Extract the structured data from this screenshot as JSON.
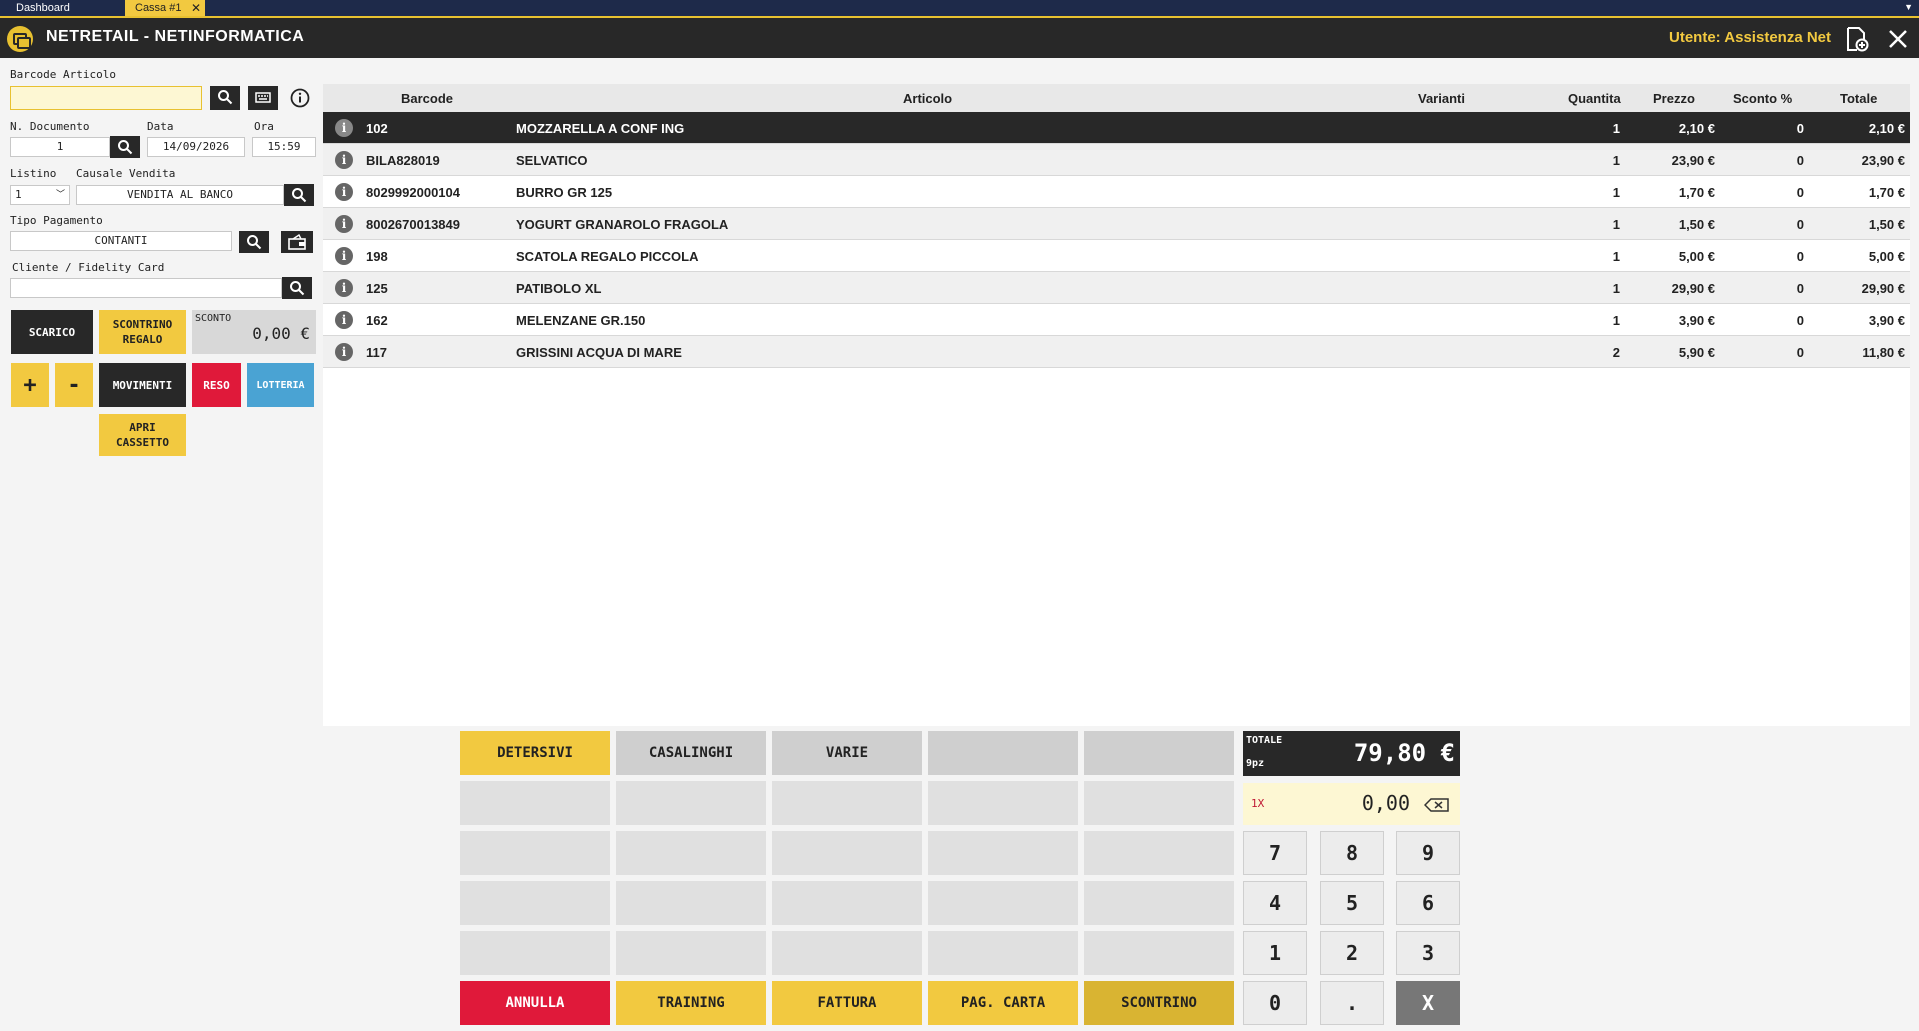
{
  "tabs": [
    {
      "label": "Dashboard"
    },
    {
      "label": "Cassa #1"
    }
  ],
  "header": {
    "title": "NETRETAIL - NETINFORMATICA",
    "user": "Utente: Assistenza Net"
  },
  "form": {
    "barcode_label": "Barcode Articolo",
    "barcode_value": "",
    "ndoc_label": "N. Documento",
    "ndoc_value": "1",
    "data_label": "Data",
    "data_value": "14/09/2026",
    "ora_label": "Ora",
    "ora_value": "15:59",
    "listino_label": "Listino",
    "listino_value": "1",
    "causale_label": "Causale Vendita",
    "causale_value": "VENDITA AL BANCO",
    "tipo_pag_label": "Tipo Pagamento",
    "tipo_pag_value": "CONTANTI",
    "cliente_label": "Cliente / Fidelity Card",
    "cliente_value": ""
  },
  "actions": {
    "scarico": "SCARICO",
    "scontrino_regalo": "SCONTRINO REGALO",
    "sconto_label": "SCONTO",
    "sconto_value": "0,00 €",
    "plus": "+",
    "minus": "-",
    "movimenti": "MOVIMENTI",
    "reso": "RESO",
    "lotteria": "LOTTERIA",
    "apri_cassetto": "APRI CASSETTO"
  },
  "table": {
    "headers": [
      "Barcode",
      "Articolo",
      "Varianti",
      "Quantita",
      "Prezzo",
      "Sconto %",
      "Totale"
    ],
    "rows": [
      {
        "barcode": "102",
        "articolo": "MOZZARELLA A CONF ING",
        "varianti": "",
        "quantita": "1",
        "prezzo": "2,10 €",
        "sconto": "0",
        "totale": "2,10 €"
      },
      {
        "barcode": "BILA828019",
        "articolo": "SELVATICO",
        "varianti": "",
        "quantita": "1",
        "prezzo": "23,90 €",
        "sconto": "0",
        "totale": "23,90 €"
      },
      {
        "barcode": "8029992000104",
        "articolo": "BURRO GR 125",
        "varianti": "",
        "quantita": "1",
        "prezzo": "1,70 €",
        "sconto": "0",
        "totale": "1,70 €"
      },
      {
        "barcode": "8002670013849",
        "articolo": "YOGURT GRANAROLO FRAGOLA",
        "varianti": "",
        "quantita": "1",
        "prezzo": "1,50 €",
        "sconto": "0",
        "totale": "1,50 €"
      },
      {
        "barcode": "198",
        "articolo": "SCATOLA REGALO PICCOLA",
        "varianti": "",
        "quantita": "1",
        "prezzo": "5,00 €",
        "sconto": "0",
        "totale": "5,00 €"
      },
      {
        "barcode": "125",
        "articolo": "PATIBOLO XL",
        "varianti": "",
        "quantita": "1",
        "prezzo": "29,90 €",
        "sconto": "0",
        "totale": "29,90 €"
      },
      {
        "barcode": "162",
        "articolo": "MELENZANE GR.150",
        "varianti": "",
        "quantita": "1",
        "prezzo": "3,90 €",
        "sconto": "0",
        "totale": "3,90 €"
      },
      {
        "barcode": "117",
        "articolo": "GRISSINI ACQUA DI MARE",
        "varianti": "",
        "quantita": "2",
        "prezzo": "5,90 €",
        "sconto": "0",
        "totale": "11,80 €"
      }
    ]
  },
  "categories": [
    "DETERSIVI",
    "CASALINGHI",
    "VARIE"
  ],
  "bottom_buttons": [
    "ANNULLA",
    "TRAINING",
    "FATTURA",
    "PAG. CARTA",
    "SCONTRINO"
  ],
  "totals": {
    "label": "TOTALE",
    "value": "79,80 €",
    "pieces": "9pz",
    "multiplier": "1X",
    "input_value": "0,00"
  },
  "keypad": [
    "7",
    "8",
    "9",
    "4",
    "5",
    "6",
    "1",
    "2",
    "3",
    "0",
    ".",
    "X"
  ],
  "colors": {
    "yellow": "#f2c940",
    "dark": "#282828",
    "red": "#e0193a",
    "blue": "#4aa3d3"
  }
}
